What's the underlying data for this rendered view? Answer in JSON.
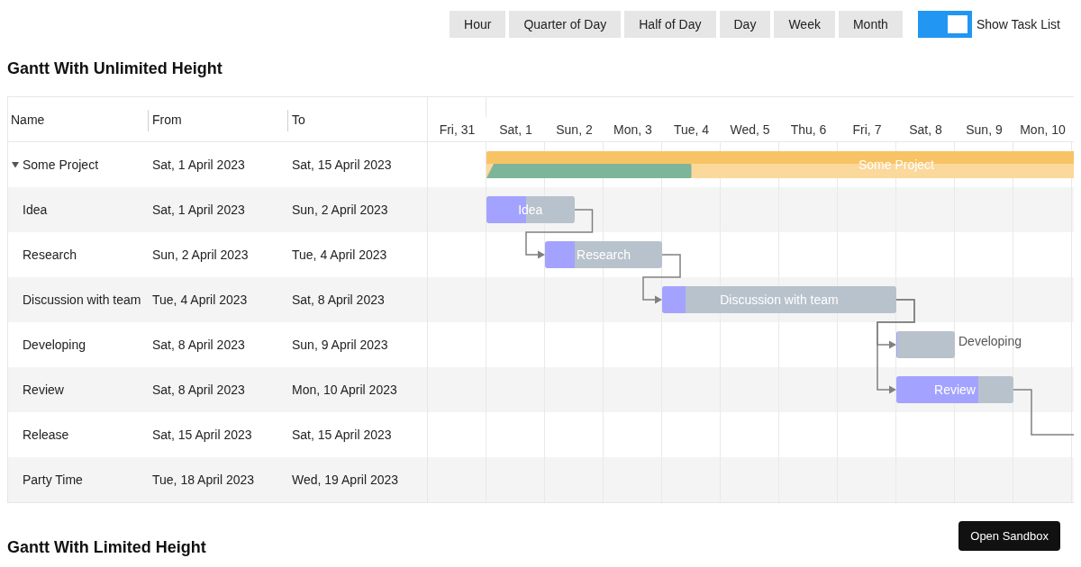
{
  "toolbar": {
    "view_modes": [
      "Hour",
      "Quarter of Day",
      "Half of Day",
      "Day",
      "Week",
      "Month"
    ],
    "show_task_list": {
      "label": "Show Task List",
      "on": true
    }
  },
  "title": "Gantt With Unlimited Height",
  "gantt": {
    "columns": [
      "Name",
      "From",
      "To"
    ],
    "tasks": [
      {
        "name": "Some Project",
        "from": "Sat, 1 April 2023",
        "to": "Sat, 15 April 2023",
        "expanded": true,
        "children": [
          {
            "name": "Idea",
            "from": "Sat, 1 April 2023",
            "to": "Sun, 2 April 2023"
          },
          {
            "name": "Research",
            "from": "Sun, 2 April 2023",
            "to": "Tue, 4 April 2023"
          },
          {
            "name": "Discussion with team",
            "from": "Tue, 4 April 2023",
            "to": "Sat, 8 April 2023"
          },
          {
            "name": "Developing",
            "from": "Sat, 8 April 2023",
            "to": "Sun, 9 April 2023"
          },
          {
            "name": "Review",
            "from": "Sat, 8 April 2023",
            "to": "Mon, 10 April 2023"
          },
          {
            "name": "Release",
            "from": "Sat, 15 April 2023",
            "to": "Sat, 15 April 2023"
          },
          {
            "name": "Party Time",
            "from": "Tue, 18 April 2023",
            "to": "Wed, 19 April 2023"
          }
        ]
      }
    ],
    "days": [
      "Fri, 31",
      "Sat, 1",
      "Sun, 2",
      "Mon, 3",
      "Tue, 4",
      "Wed, 5",
      "Thu, 6",
      "Fri, 7",
      "Sat, 8",
      "Sun, 9",
      "Mon, 10"
    ],
    "bars": [
      {
        "kind": "project",
        "label": "Some Project",
        "level": 0.25
      },
      {
        "kind": "task",
        "label": "Idea",
        "level": 0.45
      },
      {
        "kind": "task",
        "label": "Research",
        "level": 0.25
      },
      {
        "kind": "task",
        "label": "Discussion with team",
        "level": 0.1
      },
      {
        "kind": "task",
        "label": "Developing",
        "level": 0.02
      },
      {
        "kind": "task",
        "label": "Review",
        "level": 0.7
      }
    ]
  },
  "footer": {
    "button": "Open Sandbox",
    "title": "Gantt With Limited Height"
  }
}
